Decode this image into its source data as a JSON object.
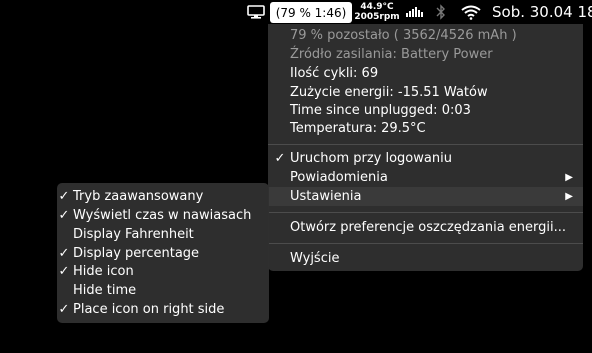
{
  "menubar": {
    "battery_text": "(79 % 1:46)",
    "temperature": "44.9°C",
    "fan_rpm": "2005rpm",
    "clock": "Sob. 30.04  18"
  },
  "info": {
    "remaining": "79 % pozostało ( 3562/4526 mAh )",
    "power_source": "Źródło zasilania: Battery Power",
    "cycles": "Ilość cykli: 69",
    "energy": "Zużycie energii: -15.51 Watów",
    "since_unplugged": "Time since unplugged: 0:03",
    "temperature": "Temperatura: 29.5°C"
  },
  "main_menu": {
    "launch_at_login": "Uruchom przy logowaniu",
    "notifications": "Powiadomienia",
    "settings": "Ustawienia",
    "open_prefs": "Otwórz preferencje oszczędzania energii...",
    "quit": "Wyjście"
  },
  "settings_menu": {
    "items": [
      {
        "label": "Tryb zaawansowany",
        "checked": true
      },
      {
        "label": "Wyświetl czas w nawiasach",
        "checked": true
      },
      {
        "label": "Display Fahrenheit",
        "checked": false
      },
      {
        "label": "Display percentage",
        "checked": true
      },
      {
        "label": "Hide icon",
        "checked": true
      },
      {
        "label": "Hide time",
        "checked": false
      },
      {
        "label": "Place icon on right side",
        "checked": true
      }
    ]
  },
  "symbols": {
    "check": "✓",
    "arrow": "▶"
  }
}
